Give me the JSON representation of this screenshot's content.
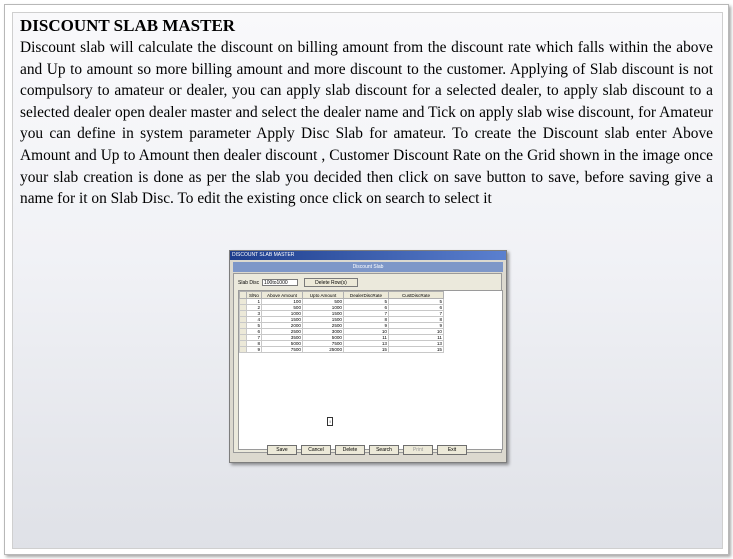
{
  "heading": "DISCOUNT SLAB MASTER",
  "paragraph": "Discount slab will calculate the discount on billing amount from the discount rate which falls within the above and Up to amount so more billing amount and more discount to the customer. Applying of Slab discount is not compulsory to amateur or dealer, you can apply slab discount for a selected dealer, to apply slab discount to a selected dealer open dealer master and select the dealer name and Tick on apply slab wise discount, for Amateur you can define in system parameter  Apply Disc Slab for amateur.   To create the Discount slab enter Above Amount and Up to Amount then  dealer discount , Customer Discount Rate on the Grid shown in the image once your slab creation is done as per the slab you decided then click on save button to save, before saving give a name for it on Slab Disc. To edit the existing once click on search to select it",
  "screenshot": {
    "window_title": "DISCOUNT SLAB MASTER",
    "header": "Discount Slab",
    "slab_label": "Slab Disc",
    "slab_value": "100to1000",
    "delete_button": "Delete Row(s)",
    "columns": [
      "SlNo",
      "Above Amount",
      "Upto Amount",
      "DealerDiscRate",
      "CustDiscRate"
    ],
    "rows": [
      [
        "1",
        "100",
        "500",
        "5",
        "5"
      ],
      [
        "2",
        "500",
        "1000",
        "6",
        "6"
      ],
      [
        "3",
        "1000",
        "1500",
        "7",
        "7"
      ],
      [
        "4",
        "1500",
        "1500",
        "8",
        "8"
      ],
      [
        "5",
        "2000",
        "2500",
        "9",
        "9"
      ],
      [
        "6",
        "2500",
        "3000",
        "10",
        "10"
      ],
      [
        "7",
        "3500",
        "5000",
        "11",
        "11"
      ],
      [
        "8",
        "5000",
        "7500",
        "13",
        "13"
      ],
      [
        "9",
        "7500",
        "25000",
        "15",
        "15"
      ]
    ],
    "cursor_glyph": "I",
    "buttons": {
      "save": "Save",
      "cancel": "Cancel",
      "delete": "Delete",
      "search": "Search",
      "print": "Print",
      "exit": "Exit"
    }
  }
}
